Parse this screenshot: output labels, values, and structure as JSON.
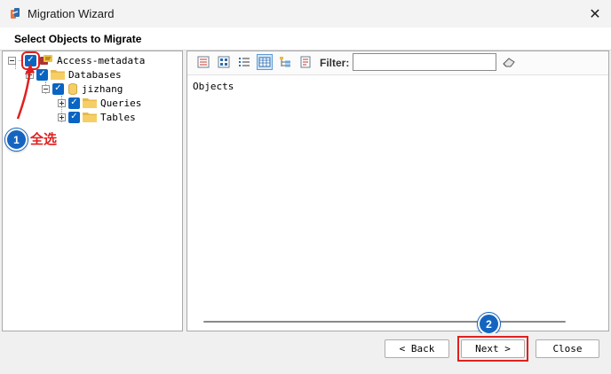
{
  "window": {
    "title": "Migration Wizard",
    "close_symbol": "✕"
  },
  "header": {
    "title": "Select Objects to Migrate"
  },
  "tree": {
    "root_label": "Access-metadata",
    "databases_label": "Databases",
    "db_label": "jizhang",
    "queries_label": "Queries",
    "tables_label": "Tables",
    "check_mark": "✓"
  },
  "toolbar": {
    "buttons": [
      "details-view",
      "large-icons-view",
      "list-view",
      "grid-view",
      "tree-view",
      "properties"
    ],
    "active_button": "grid-view",
    "filter_label": "Filter:",
    "filter_value": ""
  },
  "content": {
    "objects_label": "Objects"
  },
  "annotations": {
    "step1_number": "1",
    "step1_text": "全选",
    "step2_number": "2",
    "highlight_color": "#e02020",
    "badge_color": "#1565c0"
  },
  "footer": {
    "back_label": "< Back",
    "next_label": "Next >",
    "close_label": "Close"
  }
}
